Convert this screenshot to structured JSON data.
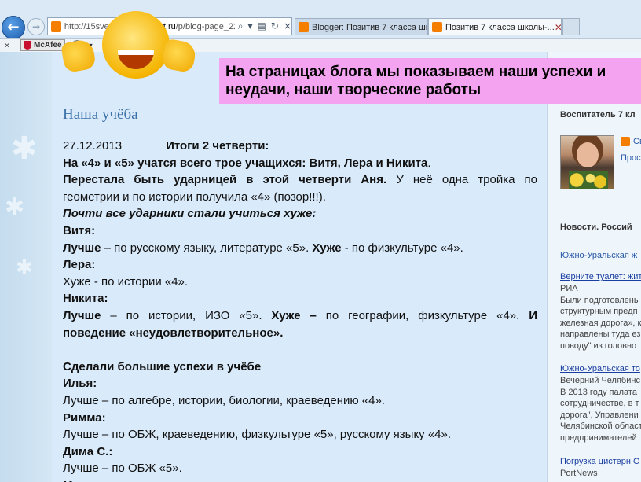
{
  "browser": {
    "address_plain_pre": "http://15svet1604.",
    "address_domain": "blogspot.ru",
    "address_plain_post": "/p/blog-page_22.htm",
    "tabs": [
      {
        "label": "Blogger: Позитив 7 класса шк...",
        "active": false
      },
      {
        "label": "Позитив 7 класса школы-...",
        "active": true
      }
    ],
    "toolbar": {
      "close_glyph": "×",
      "mcafee_label": "McAfee",
      "help_glyph": "?",
      "dropdown_glyph": "▼"
    }
  },
  "banner": {
    "line1": "На страницах блога мы показываем наши успехи и",
    "line2": "неудачи, наши творческие работы"
  },
  "post": {
    "title": "Наша учёба",
    "date": "27.12.2013",
    "heading": "Итоги 2 четверти:",
    "l1_bold": "На «4» и «5»  учатся всего трое учащихся: Витя, Лера и Никита",
    "l1_end": ".",
    "l2_bold": "Перестала быть ударницей в этой четверти Аня.",
    "l2_rest": " У неё одна тройка по",
    "l3": "геометрии и по истории получила  «4» (позор!!!).",
    "l4_italic": "Почти все ударники стали учиться хуже:",
    "vitya": "Витя:",
    "vitya_better_b": "Лучше",
    "vitya_better": " – по русскому языку, литературе «5». ",
    "vitya_worse_b": "Хуже",
    "vitya_worse": " - по физкультуре «4».",
    "lera": "Лера:",
    "lera_line": "Хуже - по истории «4».",
    "nikita": "Никита:",
    "nikita_better_b": "Лучше",
    "nikita_better": " – по истории, ИЗО «5». ",
    "nikita_worse_b": "Хуже –",
    "nikita_worse": " по географии, физкультуре «4». ",
    "nikita_and": "И",
    "nikita_behav": "поведение «неудовлетворительное».",
    "success_head": "Сделали большие успехи в учёбе",
    "ilya": "Илья:",
    "ilya_line": "Лучше – по алгебре, истории, биологии, краеведению «4».",
    "rimma": "Римма:",
    "rimma_line": "Лучше – по ОБЖ, краеведению, физкультуре «5»,  русскому языку «4».",
    "dima": "Дима С.:",
    "dima_line": "Лучше – по ОБЖ «5».",
    "cut": "М"
  },
  "sidebar": {
    "teacher_head": "Воспитатель 7 кл",
    "blogger_label": "Св",
    "profile_link": "Прос",
    "news_head": "Новости. Россий",
    "news_region": "Южно-Уральская ж",
    "items": [
      {
        "link": "Верните туалет: жит",
        "lines": [
          "РИА",
          "Были подготовлены",
          "структурным предп",
          "железная дорога», к",
          "направлены туда ез",
          "поводу\" из головно"
        ]
      },
      {
        "link": "Южно-Уральская то",
        "lines": [
          "Вечерний Челябинс",
          "В 2013 году палата",
          "сотрудничестве, в т",
          "дорога\", Управлени",
          "Челябинской област",
          "предпринимателей"
        ]
      },
      {
        "link": "Погрузка цистерн О",
        "lines": [
          "PortNews"
        ]
      }
    ]
  }
}
